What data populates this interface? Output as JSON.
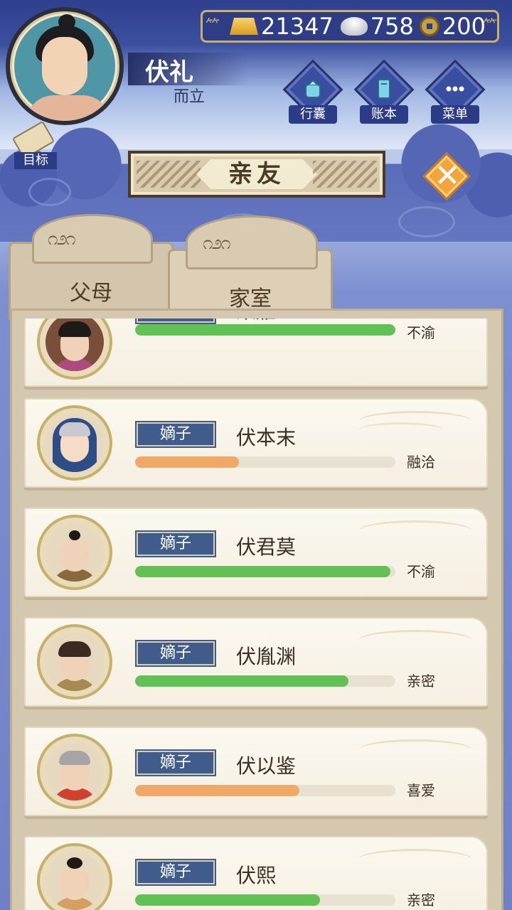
{
  "player": {
    "name": "伏礼",
    "age_title": "而立"
  },
  "currency": {
    "gold": "21347",
    "silver": "758",
    "coin": "200"
  },
  "menu": [
    {
      "label": "行囊",
      "icon": "bag-icon"
    },
    {
      "label": "账本",
      "icon": "ledger-icon"
    },
    {
      "label": "菜单",
      "icon": "more-icon"
    }
  ],
  "goal": {
    "label": "目标"
  },
  "title": "亲友",
  "tabs": [
    {
      "label": "父母",
      "active": false
    },
    {
      "label": "家室",
      "active": true
    }
  ],
  "members": [
    {
      "role": "妻子",
      "name": "乘雁",
      "relation": "不渝",
      "affinity": 1.0,
      "bar_color": "#62c155"
    },
    {
      "role": "嫡子",
      "name": "伏本末",
      "relation": "融洽",
      "affinity": 0.4,
      "bar_color": "#f0a866"
    },
    {
      "role": "嫡子",
      "name": "伏君莫",
      "relation": "不渝",
      "affinity": 0.98,
      "bar_color": "#62c155"
    },
    {
      "role": "嫡子",
      "name": "伏胤渊",
      "relation": "亲密",
      "affinity": 0.82,
      "bar_color": "#62c155"
    },
    {
      "role": "嫡子",
      "name": "伏以鉴",
      "relation": "喜爱",
      "affinity": 0.63,
      "bar_color": "#f0a866"
    },
    {
      "role": "嫡子",
      "name": "伏熙",
      "relation": "亲密",
      "affinity": 0.71,
      "bar_color": "#62c155"
    }
  ]
}
